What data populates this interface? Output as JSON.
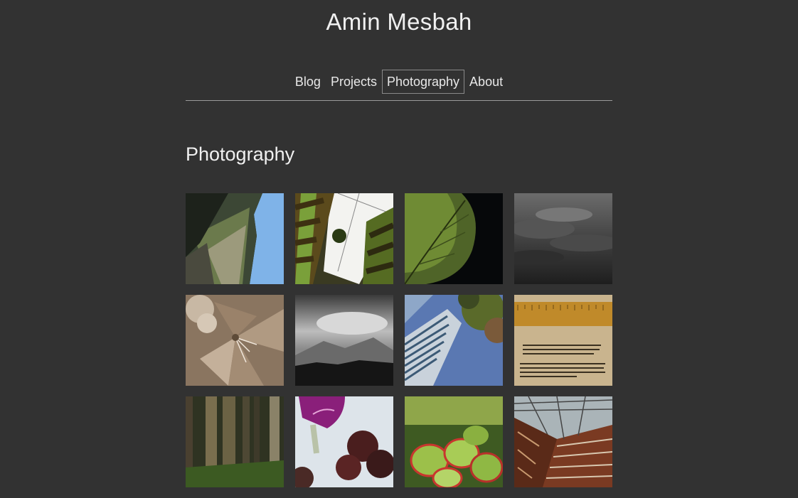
{
  "site": {
    "title": "Amin Mesbah"
  },
  "nav": {
    "items": [
      {
        "label": "Blog",
        "active": false
      },
      {
        "label": "Projects",
        "active": false
      },
      {
        "label": "Photography",
        "active": true
      },
      {
        "label": "About",
        "active": false
      }
    ]
  },
  "page": {
    "heading": "Photography"
  },
  "gallery": {
    "photos": [
      {
        "name": "rock-cliff-photo"
      },
      {
        "name": "striped-plant-photo"
      },
      {
        "name": "green-leaf-photo"
      },
      {
        "name": "storm-clouds-photo"
      },
      {
        "name": "sepia-lily-photo"
      },
      {
        "name": "mountain-clouds-photo"
      },
      {
        "name": "skyscraper-photo"
      },
      {
        "name": "brass-ruler-card-photo"
      },
      {
        "name": "forest-trees-photo"
      },
      {
        "name": "purple-flower-photo"
      },
      {
        "name": "succulent-photo"
      },
      {
        "name": "iron-atrium-photo"
      }
    ]
  }
}
